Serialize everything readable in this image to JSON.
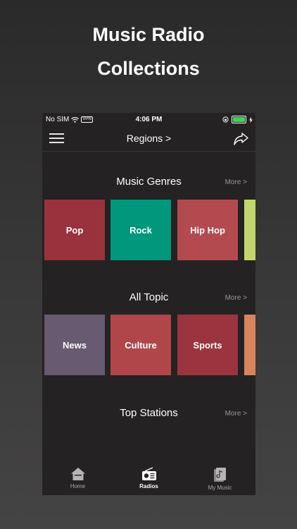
{
  "promo": {
    "line1": "Music Radio",
    "line2": "Collections"
  },
  "status_bar": {
    "carrier": "No SIM",
    "vpn": "VPN",
    "time": "4:06 PM"
  },
  "nav": {
    "title": "Regions >"
  },
  "sections": {
    "genres": {
      "title": "Music Genres",
      "more": "More >",
      "tiles": [
        {
          "label": "Pop",
          "color": "#9a323d"
        },
        {
          "label": "Rock",
          "color": "#00977c"
        },
        {
          "label": "Hip Hop",
          "color": "#b34a50"
        },
        {
          "label": "",
          "color": "#c3d66e"
        }
      ]
    },
    "topics": {
      "title": "All Topic",
      "more": "More >",
      "tiles": [
        {
          "label": "News",
          "color": "#685a70"
        },
        {
          "label": "Culture",
          "color": "#b1464a"
        },
        {
          "label": "Sports",
          "color": "#9c3440"
        },
        {
          "label": "",
          "color": "#d9845c"
        }
      ]
    },
    "stations": {
      "title": "Top Stations",
      "more": "More >"
    }
  },
  "tabs": [
    {
      "label": "Home",
      "icon": "home-icon",
      "active": false
    },
    {
      "label": "Radios",
      "icon": "radio-icon",
      "active": true
    },
    {
      "label": "My Music",
      "icon": "music-library-icon",
      "active": false
    }
  ],
  "colors": {
    "battery": "#3fd35a",
    "background": "#242222"
  }
}
